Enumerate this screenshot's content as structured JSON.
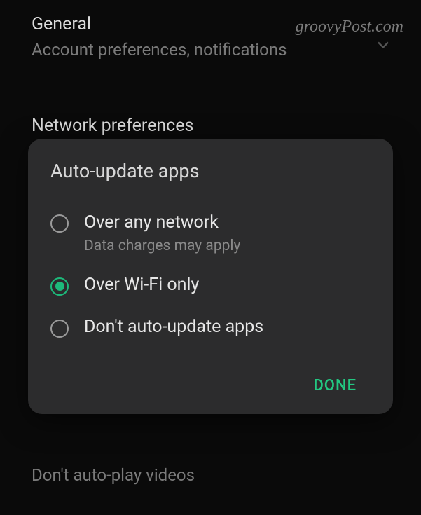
{
  "watermark": "groovyPost.com",
  "sections": {
    "general": {
      "title": "General",
      "subtitle": "Account preferences, notifications"
    },
    "network": {
      "title": "Network preferences"
    },
    "autoplay": {
      "subtitle": "Don't auto-play videos"
    }
  },
  "dialog": {
    "title": "Auto-update apps",
    "options": [
      {
        "label": "Over any network",
        "sublabel": "Data charges may apply",
        "selected": false
      },
      {
        "label": "Over Wi-Fi only",
        "selected": true
      },
      {
        "label": "Don't auto-update apps",
        "selected": false
      }
    ],
    "done": "DONE"
  }
}
